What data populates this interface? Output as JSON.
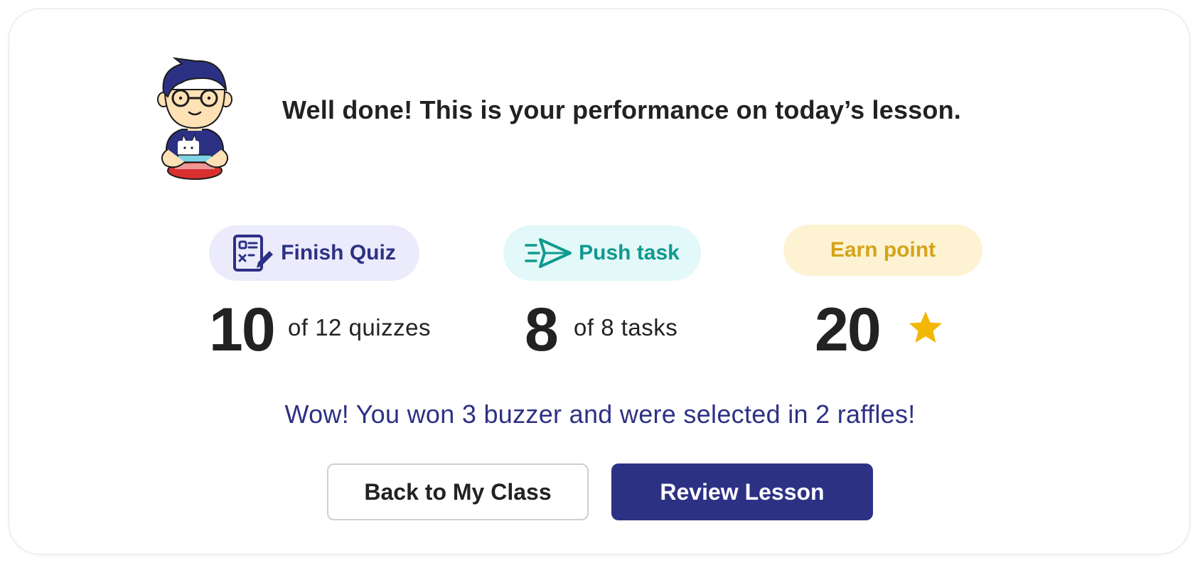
{
  "header": {
    "message": "Well done! This is your performance on today’s lesson."
  },
  "stats": [
    {
      "label": "Finish Quiz",
      "value": "10",
      "detail": "of 12 quizzes",
      "icon": "quiz-icon"
    },
    {
      "label": "Push task",
      "value": "8",
      "detail": "of 8 tasks",
      "icon": "paper-plane-icon"
    },
    {
      "label": "Earn point",
      "value": "20",
      "icon": "star-icon"
    }
  ],
  "reward_message": "Wow! You won 3 buzzer and were selected in 2 raffles!",
  "buttons": {
    "back_label": "Back to My Class",
    "review_label": "Review Lesson"
  },
  "colors": {
    "primary": "#2d3184",
    "quiz_bg": "#ecebfb",
    "push_bg": "#e3f8f8",
    "push_text": "#0f9a8e",
    "earn_bg": "#fdf3d3",
    "earn_text": "#d4a418",
    "star": "#f2b705"
  }
}
